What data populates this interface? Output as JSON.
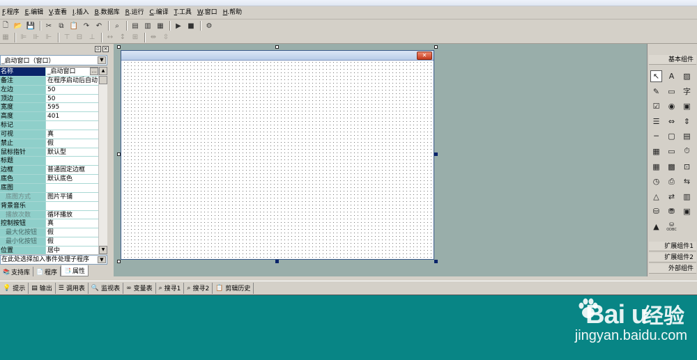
{
  "menubar": {
    "items": [
      {
        "key": "F",
        "label": ".程序"
      },
      {
        "key": "E",
        "label": ".编辑"
      },
      {
        "key": "V",
        "label": ".查看"
      },
      {
        "key": "I",
        "label": ".插入"
      },
      {
        "key": "B",
        "label": ".数据库"
      },
      {
        "key": "R",
        "label": ".运行"
      },
      {
        "key": "C",
        "label": ".编译"
      },
      {
        "key": "T",
        "label": ".工具"
      },
      {
        "key": "W",
        "label": ".窗口"
      },
      {
        "key": "H",
        "label": ".帮助"
      }
    ]
  },
  "toolbar1": {
    "icons": [
      "new-file-icon",
      "open-folder-icon",
      "save-icon",
      "cut-icon",
      "copy-icon",
      "paste-icon",
      "redo-icon",
      "undo-icon",
      "find-icon",
      "layout-left-icon",
      "layout-top-icon",
      "layout-split-icon",
      "run-icon",
      "stop-icon",
      "debug-icon"
    ]
  },
  "toolbar2": {
    "icons": [
      "grid-icon",
      "align-left-icon",
      "align-center-v-icon",
      "align-right-icon",
      "align-top-icon",
      "align-middle-icon",
      "align-bottom-icon",
      "same-width-icon",
      "same-height-icon",
      "same-size-icon",
      "space-h-icon",
      "space-v-icon"
    ]
  },
  "property_panel": {
    "object_selector": "_启动窗口（窗口）",
    "rows": [
      {
        "name": "名称",
        "value": "_启动窗口",
        "selected": true
      },
      {
        "name": "备注",
        "value": "在程序启动后自动"
      },
      {
        "name": "左边",
        "value": "50"
      },
      {
        "name": "顶边",
        "value": "50"
      },
      {
        "name": "宽度",
        "value": "595"
      },
      {
        "name": "高度",
        "value": "401"
      },
      {
        "name": "标记",
        "value": ""
      },
      {
        "name": "可视",
        "value": "真"
      },
      {
        "name": "禁止",
        "value": "假"
      },
      {
        "name": "鼠标指针",
        "value": "默认型"
      },
      {
        "name": "标题",
        "value": ""
      },
      {
        "name": "边框",
        "value": "普通固定边框"
      },
      {
        "name": "底色",
        "value": "默认底色"
      },
      {
        "name": "底图",
        "value": ""
      },
      {
        "name": "底图方式",
        "value": "图片平铺",
        "dimmed": true
      },
      {
        "name": "背景音乐",
        "value": ""
      },
      {
        "name": "播放次数",
        "value": "循环播放",
        "dimmed": true
      },
      {
        "name": "控制按钮",
        "value": "真"
      },
      {
        "name": "最大化按钮",
        "value": "假",
        "sub": true
      },
      {
        "name": "最小化按钮",
        "value": "假",
        "sub": true
      },
      {
        "name": "位置",
        "value": "居中"
      }
    ],
    "event_selector": "在此处选择加入事件处理子程序",
    "tabs": [
      {
        "label": "支持库",
        "icon": "library-icon"
      },
      {
        "label": "程序",
        "icon": "program-icon"
      },
      {
        "label": "属性",
        "icon": "property-icon",
        "active": true
      }
    ]
  },
  "toolbox": {
    "basic_header": "基本组件",
    "tools": [
      "pointer-icon",
      "label-icon",
      "picture-box-icon",
      "edit-box-icon",
      "button-icon",
      "font-icon",
      "checkbox-icon",
      "radio-icon",
      "frame-icon",
      "listbox-icon",
      "scroll-h-icon",
      "scroll-v-icon",
      "line-icon",
      "panel-icon",
      "combo-icon",
      "table-icon",
      "textbox-icon",
      "timer-icon",
      "grid-icon",
      "database-icon",
      "dialog-icon",
      "clock-icon",
      "printer-icon",
      "tray-icon",
      "shape-icon",
      "network-icon",
      "image-list-icon",
      "data-source-icon",
      "data-source2-icon",
      "frame2-icon",
      "chart-icon",
      "odbc-icon"
    ],
    "odbc_label": "ODBC",
    "ext1_header": "扩展组件1",
    "ext2_header": "扩展组件2",
    "external_header": "外部组件"
  },
  "bottom_tabs": [
    {
      "label": "提示",
      "icon": "hint-icon"
    },
    {
      "label": "输出",
      "icon": "output-icon"
    },
    {
      "label": "调用表",
      "icon": "callstack-icon"
    },
    {
      "label": "监视表",
      "icon": "watch-icon"
    },
    {
      "label": "变量表",
      "icon": "variables-icon"
    },
    {
      "label": "搜寻1",
      "icon": "search1-icon"
    },
    {
      "label": "搜寻2",
      "icon": "search2-icon"
    },
    {
      "label": "剪辑历史",
      "icon": "clip-history-icon"
    }
  ],
  "watermark": {
    "logo": "Bai  u",
    "cn": "经验",
    "url": "jingyan.baidu.com"
  },
  "colors": {
    "output_bg": "#088585",
    "design_bg": "#99aeaa",
    "prop_name_bg": "#8fcfca",
    "selected_bg": "#0a246a"
  }
}
